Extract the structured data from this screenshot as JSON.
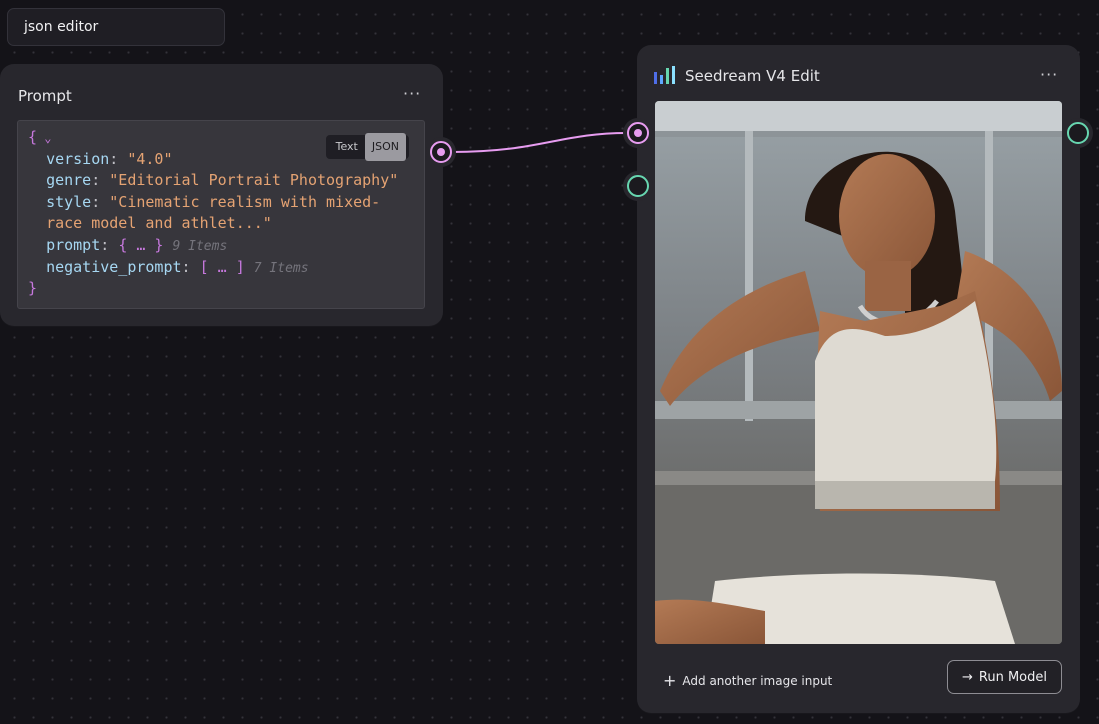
{
  "canvas": {
    "title": "json editor"
  },
  "prompt_node": {
    "title": "Prompt",
    "menu_icon": "more-horizontal-icon",
    "toggle": {
      "text": "Text",
      "json": "JSON",
      "selected": "JSON"
    },
    "json_lines": {
      "open": "{",
      "version_key": "version",
      "version_val": "\"4.0\"",
      "genre_key": "genre",
      "genre_val": "\"Editorial Portrait Photography\"",
      "style_key": "style",
      "style_val_1": "\"Cinematic realism with mixed-",
      "style_val_2": "race model and athlet...\"",
      "prompt_key": "prompt",
      "prompt_collapsed": "{ … }",
      "prompt_count": "9 Items",
      "neg_key": "negative_prompt",
      "neg_collapsed": "[ … ]",
      "neg_count": "7 Items",
      "close": "}"
    }
  },
  "model_node": {
    "title": "Seedream V4 Edit",
    "icon": "bar-chart-icon",
    "menu_icon": "more-horizontal-icon",
    "add_input_label": "Add another image input",
    "run_label": "Run Model"
  },
  "colors": {
    "accent_pink": "#e79cf0",
    "accent_green": "#67d6b0",
    "string": "#e5a373",
    "key": "#a6d7f2"
  }
}
